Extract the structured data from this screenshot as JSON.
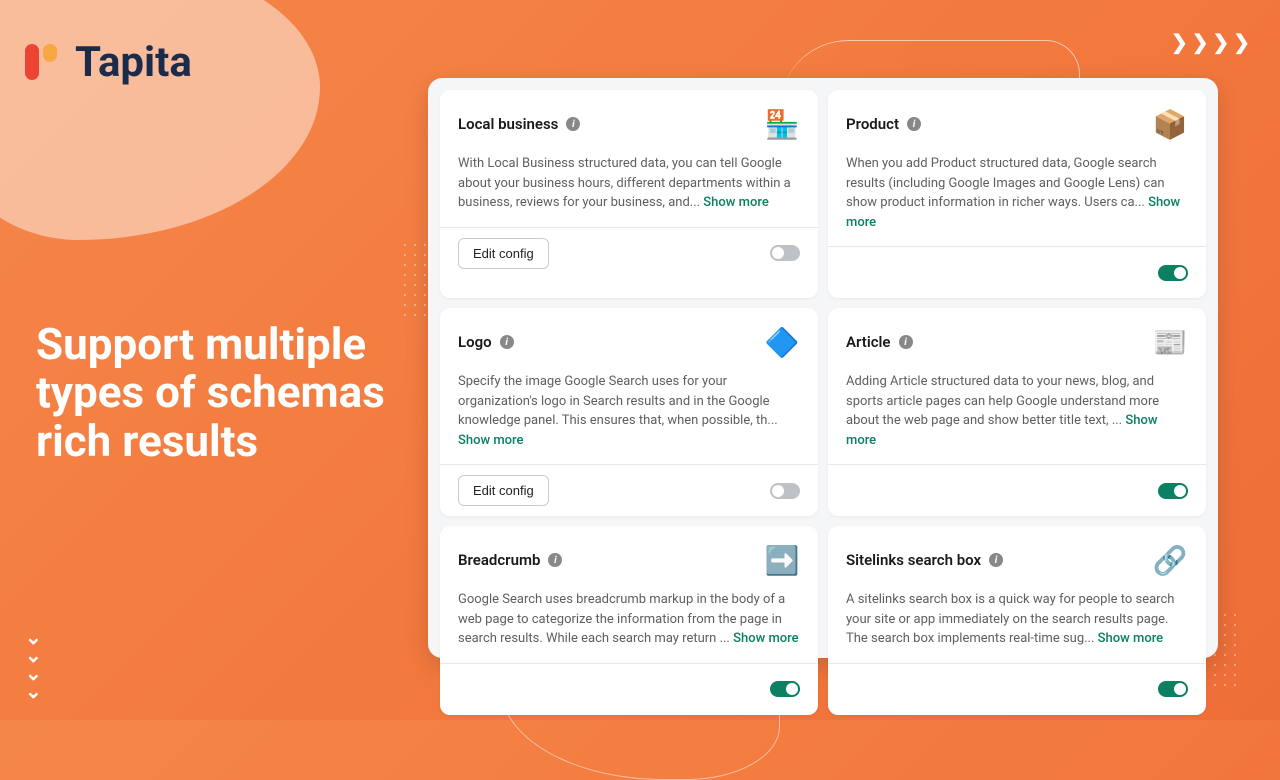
{
  "brand": "Tapita",
  "headline": "Support multiple types of schemas rich results",
  "show_more_label": "Show more",
  "edit_config_label": "Edit config",
  "cards": [
    {
      "title": "Local business",
      "icon": "🏪",
      "desc": "With Local Business structured data, you can tell Google about your business hours, different departments within a business, reviews for your business, and... ",
      "has_edit": true,
      "enabled": false
    },
    {
      "title": "Product",
      "icon": "📦",
      "desc": "When you add Product structured data, Google search results (including Google Images and Google Lens) can show product information in richer ways. Users ca... ",
      "has_edit": false,
      "enabled": true
    },
    {
      "title": "Logo",
      "icon": "🔷",
      "desc": "Specify the image Google Search uses for your organization's logo in Search results and in the Google knowledge panel. This ensures that, when possible, th... ",
      "has_edit": true,
      "enabled": false
    },
    {
      "title": "Article",
      "icon": "📰",
      "desc": "Adding Article structured data to your news, blog, and sports article pages can help Google understand more about the web page and show better title text, ... ",
      "has_edit": false,
      "enabled": true
    },
    {
      "title": "Breadcrumb",
      "icon": "➡️",
      "desc": "Google Search uses breadcrumb markup in the body of a web page to categorize the information from the page in search results. While each search may return ... ",
      "has_edit": false,
      "enabled": true
    },
    {
      "title": "Sitelinks search box",
      "icon": "🔗",
      "desc": "A sitelinks search box is a quick way for people to search your site or app immediately on the search results page. The search box implements real-time sug... ",
      "has_edit": false,
      "enabled": true
    }
  ]
}
